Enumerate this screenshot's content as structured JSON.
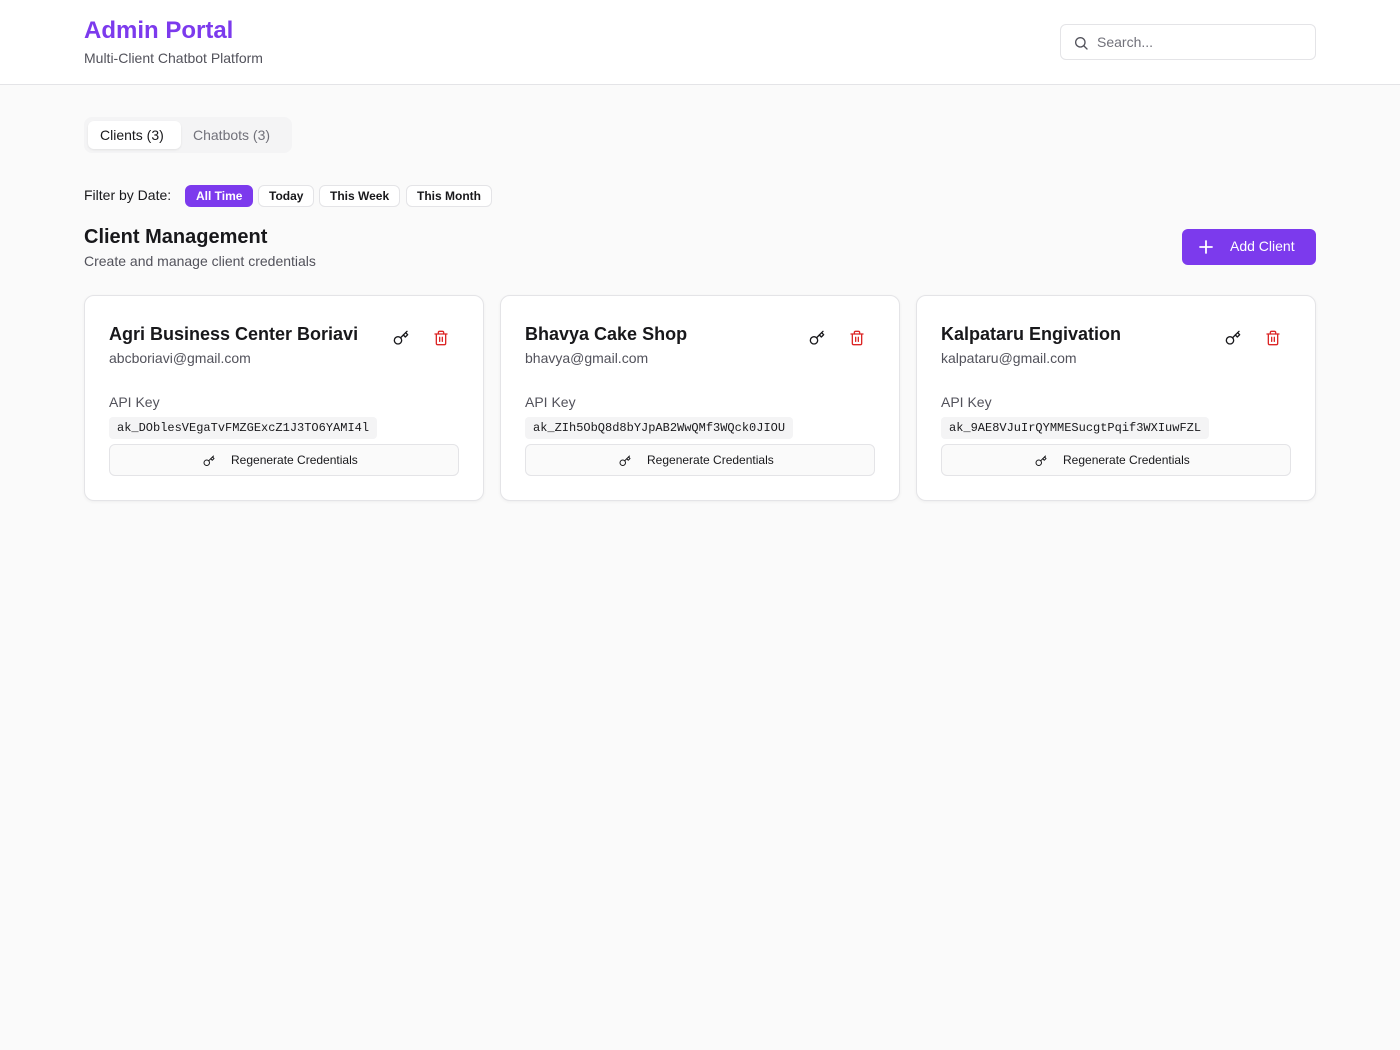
{
  "header": {
    "title": "Admin Portal",
    "subtitle": "Multi-Client Chatbot Platform",
    "search_placeholder": "Search..."
  },
  "tabs": [
    {
      "label": "Clients (3)",
      "active": true
    },
    {
      "label": "Chatbots (3)",
      "active": false
    }
  ],
  "filter": {
    "label": "Filter by Date:",
    "options": [
      "All Time",
      "Today",
      "This Week",
      "This Month"
    ],
    "selected": "All Time"
  },
  "section": {
    "title": "Client Management",
    "subtitle": "Create and manage client credentials",
    "add_label": "Add Client"
  },
  "clients": [
    {
      "name": "Agri Business Center Boriavi",
      "email": "abcboriavi@gmail.com",
      "api_label": "API Key",
      "api_key": "ak_DOblesVEgaTvFMZGExcZ1J3TO6YAMI4l",
      "regen_label": "Regenerate Credentials"
    },
    {
      "name": "Bhavya Cake Shop",
      "email": "bhavya@gmail.com",
      "api_label": "API Key",
      "api_key": "ak_ZIh5ObQ8d8bYJpAB2WwQMf3WQck0JIOU",
      "regen_label": "Regenerate Credentials"
    },
    {
      "name": "Kalpataru Engivation",
      "email": "kalpataru@gmail.com",
      "api_label": "API Key",
      "api_key": "ak_9AE8VJuIrQYMMESucgtPqif3WXIuwFZL",
      "regen_label": "Regenerate Credentials"
    }
  ],
  "colors": {
    "accent": "#7c3aed",
    "danger": "#dc2626"
  }
}
